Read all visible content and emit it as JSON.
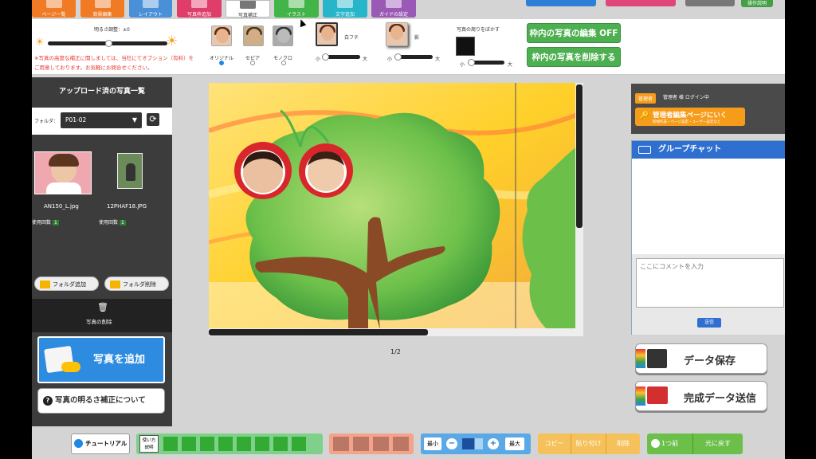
{
  "tabs": [
    {
      "label": "ページ一覧",
      "color": "#f07b24"
    },
    {
      "label": "背景編集",
      "color": "#f07b24"
    },
    {
      "label": "レイアウト",
      "color": "#4a90d9"
    },
    {
      "label": "写真枠追加",
      "color": "#e03d6b"
    },
    {
      "label": "写真補正",
      "color": "#ffffff"
    },
    {
      "label": "イラスト",
      "color": "#43b548"
    },
    {
      "label": "文字追加",
      "color": "#26b5c9"
    },
    {
      "label": "ガイドの設定",
      "color": "#9b59b6"
    }
  ],
  "top_right": {
    "help_label": "操作説明"
  },
  "toolbar": {
    "brightness_label": "明るさ調整：±0",
    "notice": "※写真の高度な補正に関しましては、当社にてオプション（有料）をご用意しております。お気軽にお問合せください。",
    "filter_options": [
      "オリジナル",
      "セピア",
      "モノクロ"
    ],
    "white_edge_label": "白フチ",
    "shadow_label": "影",
    "blur_label": "写真の周りをぼかす",
    "small_label": "小",
    "large_label": "大",
    "frame_edit_button": "枠内の写真の編集 OFF",
    "frame_delete_button": "枠内の写真を削除する"
  },
  "left_panel": {
    "title": "アップロード済の写真一覧",
    "folder_label": "フォルダ：",
    "folder_value": "P01-02",
    "photos": [
      {
        "name": "AN150_L.jpg",
        "usage_label": "使用回数",
        "usage_count": "1"
      },
      {
        "name": "12PHAF18.JPG",
        "usage_label": "使用回数",
        "usage_count": "1"
      }
    ],
    "add_folder": "フォルダ追加",
    "delete_folder": "フォルダ削除",
    "delete_photo": "写真の削除",
    "add_photo": "写真を追加",
    "brightness_help": "写真の明るさ補正について"
  },
  "canvas": {
    "page_indicator": "1/2"
  },
  "right_panel": {
    "admin_badge": "管理者",
    "admin_status": "管理者 様 ログイン中",
    "admin_link": "管理者編集ページにいく",
    "admin_link_sub": "新規作成・ページ設定・ユーザー設定など",
    "chat_title": "グループチャット",
    "comment_placeholder": "ここにコメントを入力",
    "send_button": "送信",
    "save_button": "データ保存",
    "submit_button": "完成データ送信"
  },
  "bottom_bar": {
    "tutorial": "チュートリアル",
    "usage_label_1": "使い方",
    "usage_label_2": "説明",
    "zoom_min": "最小",
    "zoom_max": "最大",
    "copy": "コピー",
    "paste": "貼り付け",
    "delete": "削除",
    "undo": "1つ前",
    "redo": "元に戻す"
  }
}
